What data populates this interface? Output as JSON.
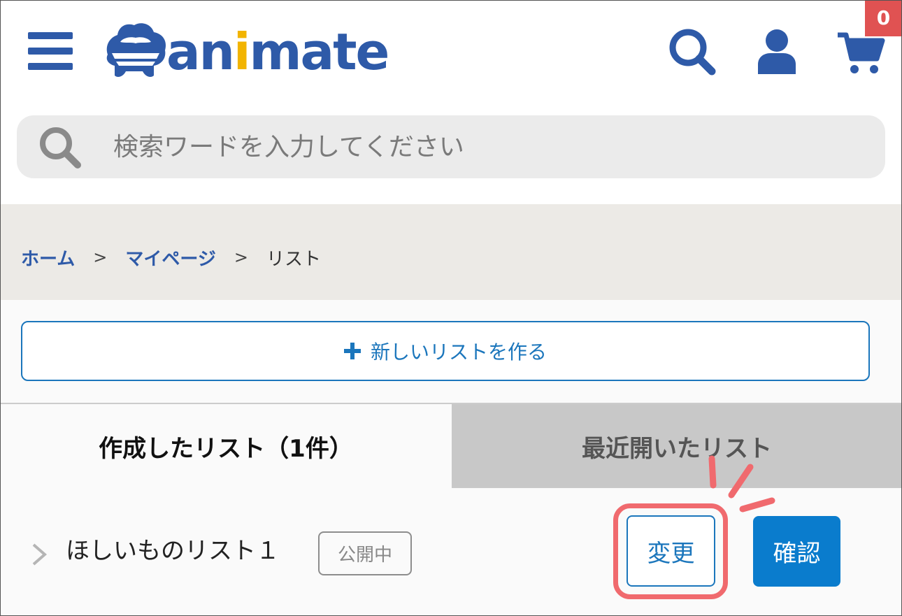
{
  "header": {
    "logo_text_pre": "an",
    "logo_text_i": "i",
    "logo_text_post": "mate",
    "cart_count": "0",
    "brand_color": "#2e5aa8",
    "accent_color": "#f2b400",
    "badge_color": "#e05252"
  },
  "search": {
    "placeholder": "検索ワードを入力してください"
  },
  "breadcrumb": {
    "home": "ホーム",
    "sep1": ">",
    "mypage": "マイページ",
    "sep2": ">",
    "current": "リスト"
  },
  "actions": {
    "new_list_label": "新しいリストを作る"
  },
  "tabs": {
    "created_label": "作成したリスト（1件）",
    "recent_label": "最近開いたリスト"
  },
  "lists": [
    {
      "name": "ほしいものリスト１",
      "status": "公開中",
      "change_label": "変更",
      "confirm_label": "確認"
    }
  ],
  "colors": {
    "primary_button": "#0a7ccd",
    "outline_blue": "#1b76bc",
    "highlight": "#f06a6e"
  },
  "icons": [
    "hamburger-menu-icon",
    "search-icon",
    "user-icon",
    "cart-icon",
    "plus-icon",
    "chevron-right-icon"
  ]
}
